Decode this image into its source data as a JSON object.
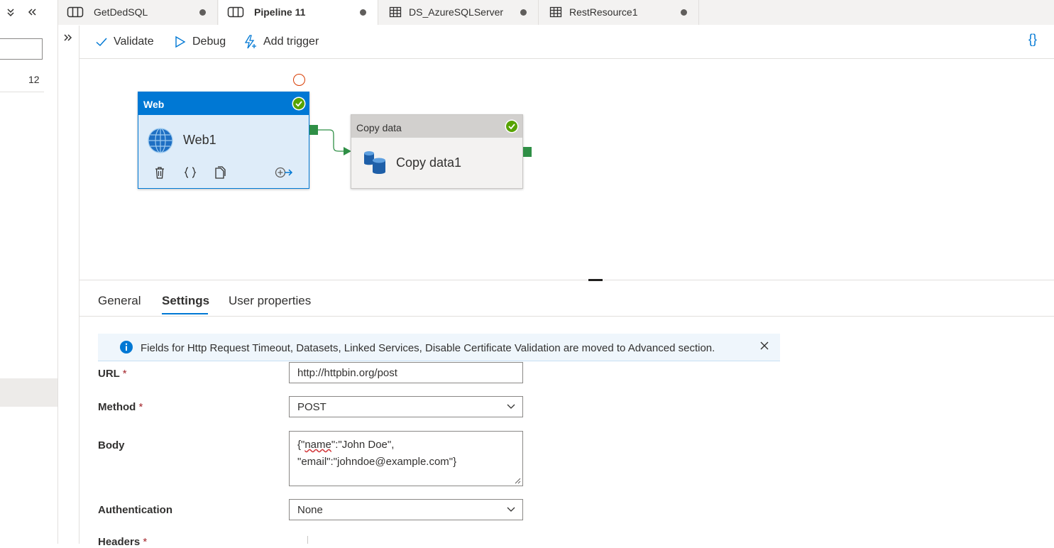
{
  "left_panel": {
    "count": "12"
  },
  "tabs": [
    {
      "label": "GetDedSQL",
      "icon": "pipeline-icon",
      "active": false
    },
    {
      "label": "Pipeline 11",
      "icon": "pipeline-icon",
      "active": true
    },
    {
      "label": "DS_AzureSQLServer",
      "icon": "table-icon",
      "active": false
    },
    {
      "label": "RestResource1",
      "icon": "table-icon",
      "active": false
    }
  ],
  "toolbar": {
    "validate_label": "Validate",
    "debug_label": "Debug",
    "add_trigger_label": "Add trigger",
    "code_symbol": "{}"
  },
  "canvas": {
    "web_activity": {
      "type": "Web",
      "name": "Web1",
      "status": "succeeded"
    },
    "copy_activity": {
      "type": "Copy data",
      "name": "Copy data1",
      "status": "succeeded"
    }
  },
  "properties": {
    "tabs": [
      "General",
      "Settings",
      "User properties"
    ],
    "active_tab": "Settings",
    "info_banner": "Fields for Http Request Timeout, Datasets, Linked Services, Disable Certificate Validation are moved to Advanced section.",
    "fields": {
      "url": {
        "label": "URL",
        "required": "*",
        "value": "http://httpbin.org/post"
      },
      "method": {
        "label": "Method",
        "required": "*",
        "value": "POST"
      },
      "body": {
        "label": "Body",
        "line1_prefix": "{\"",
        "line1_key": "name",
        "line1_rest": "\":\"John Doe\",",
        "line2": "\"email\":\"johndoe@example.com\"}"
      },
      "authentication": {
        "label": "Authentication",
        "value": "None"
      },
      "headers": {
        "label": "Headers",
        "required": "*"
      }
    }
  },
  "colors": {
    "accent": "#0078d4",
    "success": "#57a300",
    "error": "#d83b01",
    "port": "#2f8f46"
  }
}
